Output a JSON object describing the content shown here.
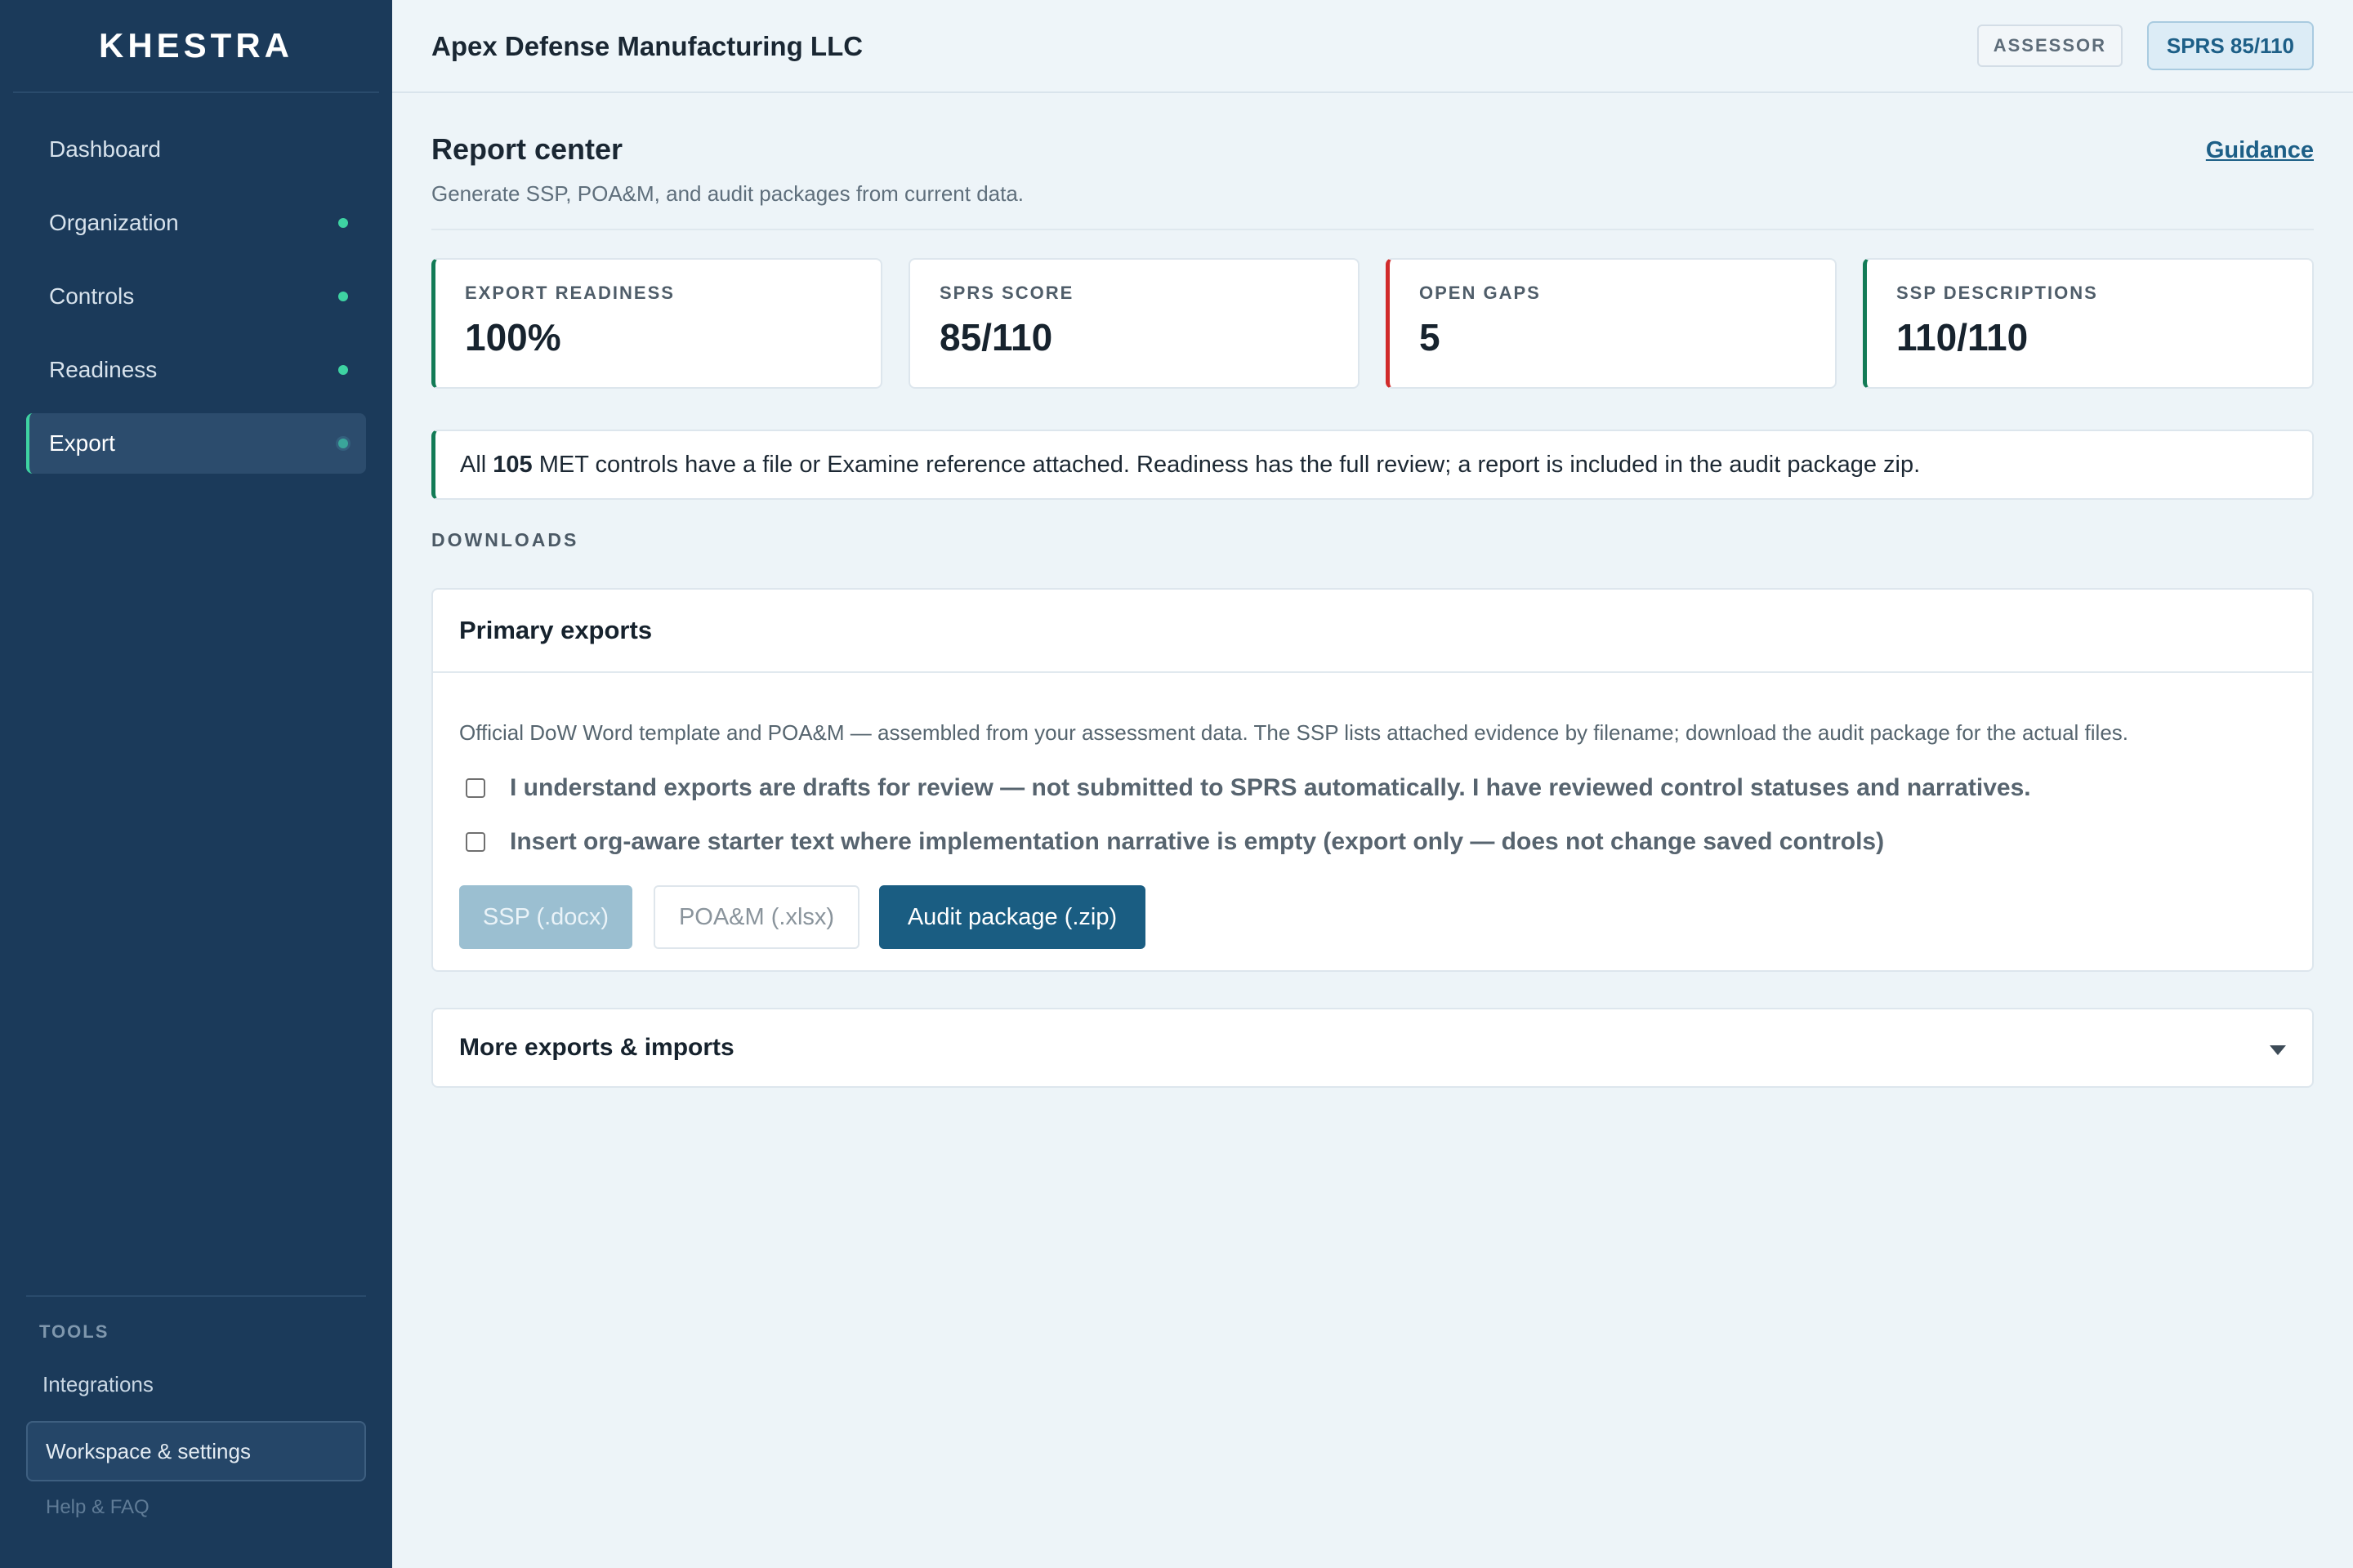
{
  "app": {
    "brand": "KHESTRA"
  },
  "sidebar": {
    "items": [
      {
        "label": "Dashboard",
        "dot": false
      },
      {
        "label": "Organization",
        "dot": true
      },
      {
        "label": "Controls",
        "dot": true
      },
      {
        "label": "Readiness",
        "dot": true
      },
      {
        "label": "Export",
        "dot": true,
        "active": true
      }
    ],
    "tools_title": "TOOLS",
    "integrations": "Integrations",
    "settings": "Workspace & settings",
    "help": "Help & FAQ"
  },
  "header": {
    "org_name": "Apex Defense Manufacturing LLC",
    "role_badge": "ASSESSOR",
    "sprs_badge": "SPRS 85/110"
  },
  "page": {
    "title": "Report center",
    "subtitle": "Generate SSP, POA&M, and audit packages from current data.",
    "guidance_link": "Guidance"
  },
  "stats": [
    {
      "label": "EXPORT READINESS",
      "value": "100%",
      "accent": "#127b56"
    },
    {
      "label": "SPRS SCORE",
      "value": "85/110",
      "accent": ""
    },
    {
      "label": "OPEN GAPS",
      "value": "5",
      "accent": "#d12b2b"
    },
    {
      "label": "SSP DESCRIPTIONS",
      "value": "110/110",
      "accent": "#127b56"
    }
  ],
  "notice": {
    "prefix": "All",
    "count": "105",
    "suffix": "MET controls have a file or Examine reference attached. Readiness has the full review; a report is included in the audit package zip."
  },
  "downloads": {
    "section_title": "DOWNLOADS",
    "primary": {
      "title": "Primary exports",
      "description": "Official DoW Word template and POA&M — assembled from your assessment data. The SSP lists attached evidence by filename; download the audit package for the actual files.",
      "checkbox_1": "I understand exports are drafts for review — not submitted to SPRS automatically. I have reviewed control statuses and narratives.",
      "checkbox_2": "Insert org-aware starter text where implementation narrative is empty (export only — does not change saved controls)",
      "btn_ssp": "SSP (.docx)",
      "btn_poam": "POA&M (.xlsx)",
      "btn_audit": "Audit package (.zip)"
    },
    "more_title": "More exports & imports"
  },
  "colors": {
    "sidebar_bg": "#1b3a5a",
    "accent_green": "#3ed3a2",
    "brand_blue": "#1a5d82",
    "gap_red": "#d12b2b"
  }
}
